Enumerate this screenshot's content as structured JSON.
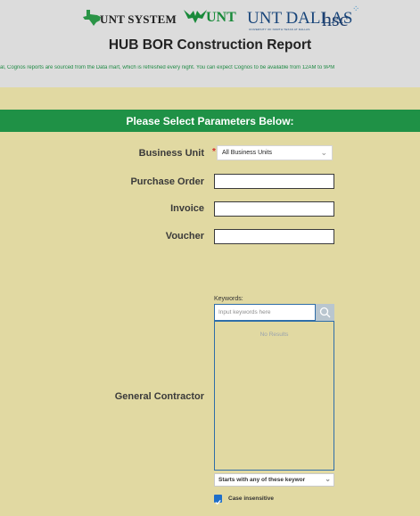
{
  "header": {
    "logos": {
      "unt_system": "UNT SYSTEM",
      "unt": "UNT",
      "unt_dallas": "UNT DALLAS",
      "unt_dallas_sub": "UNIVERSITY OF NORTH TEXAS AT DALLAS",
      "hsc": "hsc"
    },
    "title": "HUB BOR Construction Report",
    "notice": "ral, Cognos reports are sourced from the Data mart, which is refreshed every night. You can expect Cognos to be available from 12AM to 9PM"
  },
  "params_header": "Please Select Parameters Below:",
  "form": {
    "business_unit": {
      "label": "Business Unit",
      "required_mark": "*",
      "value": "All Business Units"
    },
    "purchase_order": {
      "label": "Purchase Order",
      "value": ""
    },
    "invoice": {
      "label": "Invoice",
      "value": ""
    },
    "voucher": {
      "label": "Voucher",
      "value": ""
    },
    "general_contractor": {
      "label": "General Contractor",
      "keywords_label": "Keywords:",
      "keywords_placeholder": "Input keywords here",
      "no_results": "No Results",
      "match_option": "Starts with any of these keywor",
      "case_label": "Case insensitive",
      "case_checked": true
    }
  },
  "colors": {
    "accent_green": "#1f9146",
    "background": "#e1d9a2",
    "checkbox_blue": "#1f6fc9"
  }
}
